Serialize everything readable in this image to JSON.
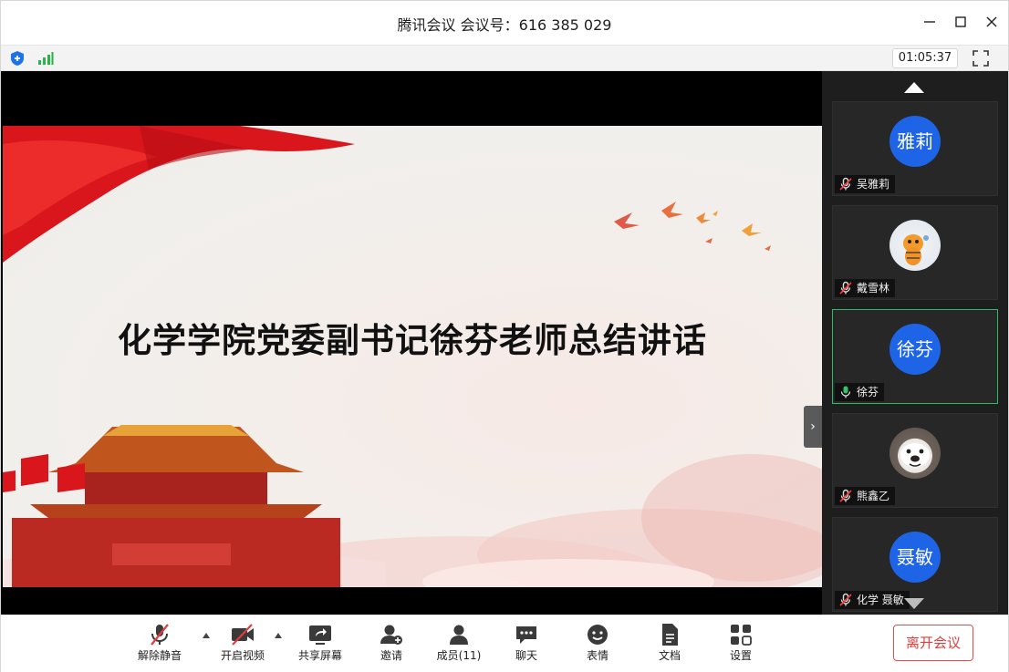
{
  "window": {
    "title": "腾讯会议 会议号：616 385 029"
  },
  "status": {
    "timer": "01:05:37"
  },
  "slide": {
    "title": "化学学院党委副书记徐芬老师总结讲话"
  },
  "participants": [
    {
      "name": "吴雅莉",
      "avatar_text": "雅莉",
      "mic": "muted",
      "avatar": "blue"
    },
    {
      "name": "戴雪林",
      "avatar_text": "",
      "mic": "muted",
      "avatar": "tiger-image"
    },
    {
      "name": "徐芬",
      "avatar_text": "徐芬",
      "mic": "on",
      "avatar": "blue"
    },
    {
      "name": "熊鑫乙",
      "avatar_text": "",
      "mic": "muted",
      "avatar": "bear-image"
    },
    {
      "name": "化学 聂敏",
      "avatar_text": "聂敏",
      "mic": "muted",
      "avatar": "blue"
    }
  ],
  "toolbar": {
    "unmute": "解除静音",
    "start_video": "开启视频",
    "share_screen": "共享屏幕",
    "invite": "邀请",
    "members": "成员(11)",
    "chat": "聊天",
    "reactions": "表情",
    "docs": "文档",
    "settings": "设置",
    "leave": "离开会议"
  },
  "colors": {
    "accent_blue": "#1e64e6",
    "leave_red": "#e23c3c",
    "speaking_green": "#2dbb6b"
  }
}
